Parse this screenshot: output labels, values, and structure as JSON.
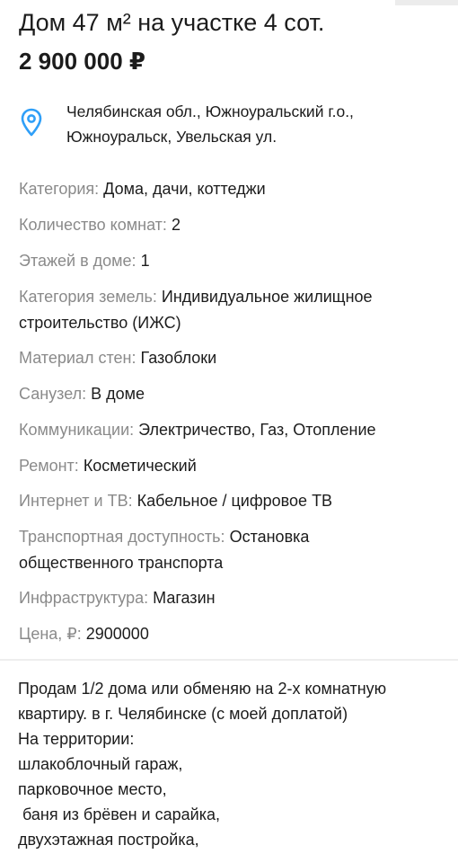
{
  "listing": {
    "title": "Дом 47 м² на участке 4 сот.",
    "price": "2 900 000 ₽",
    "address_line1": "Челябинская обл., Южноуральский г.о.,",
    "address_line2": "Южноуральск, Увельская ул.",
    "pin_icon": "location-pin-icon",
    "accent_color": "#2f9ff8"
  },
  "properties": [
    {
      "label": "Категория:",
      "value": "Дома, дачи, коттеджи"
    },
    {
      "label": "Количество комнат:",
      "value": "2"
    },
    {
      "label": "Этажей в доме:",
      "value": "1"
    },
    {
      "label": "Категория земель:",
      "value": "Индивидуальное жилищное",
      "value2": "строительство (ИЖС)"
    },
    {
      "label": "Материал стен:",
      "value": "Газоблоки"
    },
    {
      "label": "Санузел:",
      "value": "В доме"
    },
    {
      "label": "Коммуникации:",
      "value": "Электричество, Газ, Отопление"
    },
    {
      "label": "Ремонт:",
      "value": "Косметический"
    },
    {
      "label": "Интернет и ТВ:",
      "value": "Кабельное / цифровое ТВ"
    },
    {
      "label": "Транспортная доступность:",
      "value": "Остановка",
      "value2": "общественного транспорта"
    },
    {
      "label": "Инфраструктура:",
      "value": "Магазин"
    },
    {
      "label": "Цена, ₽:",
      "value": "2900000"
    }
  ],
  "description": {
    "lines": [
      "Продам 1/2 дома или обменяю на 2-х комнатную",
      "квартиру. в г. Челябинске (с моей доплатой)",
      "На территории:",
      "шлакоблочный гараж,",
      "парковочное место,",
      " баня из брёвен и сарайка,",
      "двухэтажная постройка,"
    ]
  }
}
